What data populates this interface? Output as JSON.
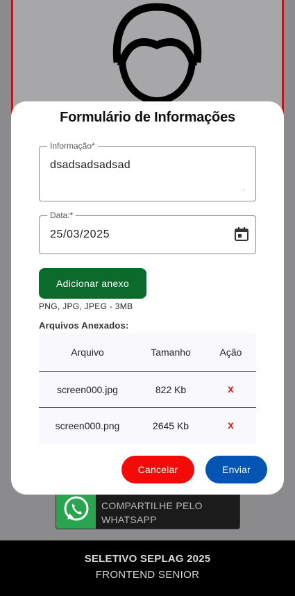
{
  "form": {
    "title": "Formulário de Informações",
    "info_label": "Informação*",
    "info_value": "dsadsadsadsad",
    "date_label": "Data:*",
    "date_value": "25/03/2025",
    "attach_button": "Adicionar anexo",
    "file_hint": "PNG, JPG, JPEG - 3MB",
    "attached_title": "Arquivos Anexados:",
    "table": {
      "headers": [
        "Arquivo",
        "Tamanho",
        "Ação"
      ],
      "rows": [
        {
          "file": "screen000.jpg",
          "size": "822 Kb",
          "action": "x"
        },
        {
          "file": "screen000.png",
          "size": "2645 Kb",
          "action": "x"
        }
      ]
    },
    "cancel_button": "Cancelar",
    "send_button": "Enviar"
  },
  "background": {
    "whatsapp_line1": "COMPARTILHE PELO",
    "whatsapp_line2": "WHATSAPP"
  },
  "footer": {
    "title": "SELETIVO SEPLAG 2025",
    "subtitle": "FRONTEND SENIOR"
  },
  "icons": {
    "avatar": "person-outline-icon",
    "calendar": "calendar-icon",
    "whatsapp": "whatsapp-icon",
    "delete": "delete-x-icon"
  },
  "colors": {
    "attach": "#0c6a2c",
    "cancel": "#f50a0a",
    "send": "#0454b4",
    "delete": "#e01e1e",
    "whatsapp": "#29a54f"
  }
}
